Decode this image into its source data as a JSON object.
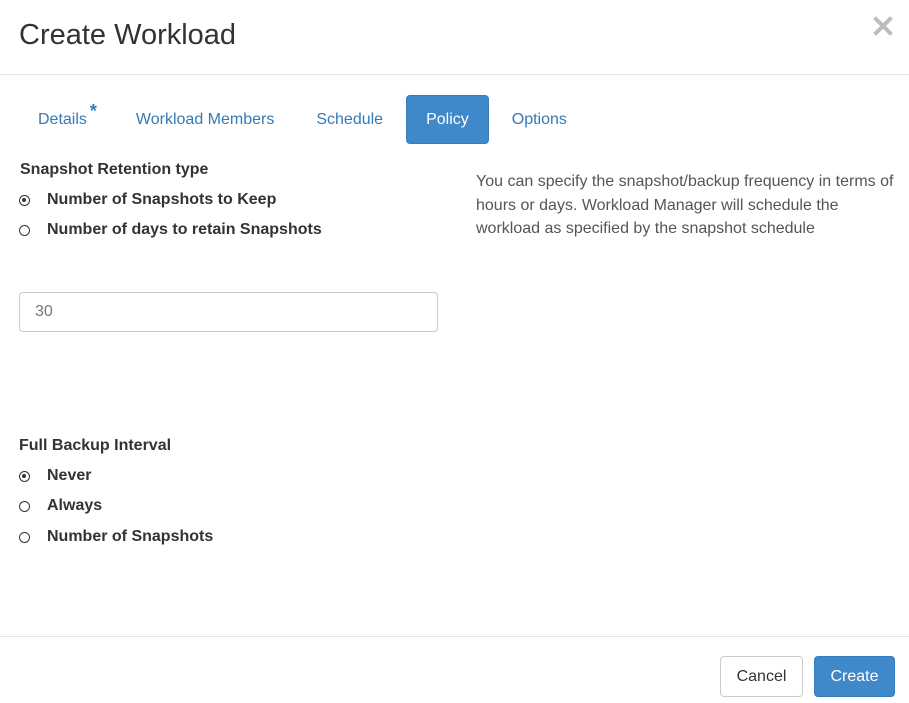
{
  "dialog": {
    "title": "Create Workload",
    "close_icon": "close-x-icon"
  },
  "tabs": [
    {
      "label": "Details",
      "required_marker": "*",
      "active": false
    },
    {
      "label": "Workload Members",
      "active": false
    },
    {
      "label": "Schedule",
      "active": false
    },
    {
      "label": "Policy",
      "active": true
    },
    {
      "label": "Options",
      "active": false
    }
  ],
  "retention": {
    "label": "Snapshot Retention type",
    "options": [
      {
        "label": "Number of Snapshots to Keep",
        "checked": true
      },
      {
        "label": "Number of days to retain Snapshots",
        "checked": false
      }
    ],
    "value_placeholder": "30"
  },
  "help_text": "You can specify the snapshot/backup frequency in terms of hours or days. Workload Manager will schedule the workload as specified by the snapshot schedule",
  "full_backup": {
    "label": "Full Backup Interval",
    "options": [
      {
        "label": "Never",
        "checked": true
      },
      {
        "label": "Always",
        "checked": false
      },
      {
        "label": "Number of Snapshots",
        "checked": false
      }
    ]
  },
  "footer": {
    "cancel_label": "Cancel",
    "create_label": "Create"
  },
  "colors": {
    "primary": "#3f88c9",
    "link": "#337ab7",
    "text": "#333333"
  }
}
